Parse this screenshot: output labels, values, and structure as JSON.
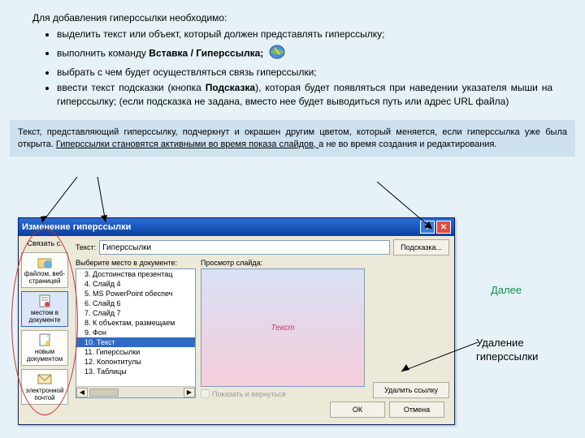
{
  "intro": {
    "heading": "Для добавления гиперссылки необходимо:",
    "li1": "выделить текст или объект, который должен представлять гиперссылку;",
    "li2a": "выполнить команду ",
    "li2b": "Вставка / Гиперссылка;",
    "li3": "выбрать с чем будет осуществляться связь гиперссылки;",
    "li4a": "ввести текст подсказки (кнопка ",
    "li4b": "Подсказка",
    "li4c": "), которая будет появляться при наведении указателя мыши на гиперссылку; (если подсказка не задана, вместо нее будет выводиться путь или адрес URL файла)"
  },
  "note": {
    "p1": "Текст, представляющий гиперссылку, подчеркнут и окрашен другим цветом, который меняется, если гиперссылка уже была открыта. ",
    "u1": "Гиперссылки становятся активными во время показа слайдов, ",
    "p2": "а не во время создания и редактирования."
  },
  "dialog": {
    "title": "Изменение гиперссылки",
    "linkto_label": "Связать с:",
    "linkto": {
      "web": "файлом, веб-страницей",
      "doc": "местом в документе",
      "new": "новым документом",
      "mail": "электронной почтой"
    },
    "text_label": "Текст:",
    "text_value": "Гиперссылки",
    "tip_btn": "Подсказка...",
    "select_label": "Выберите место в документе:",
    "preview_label": "Просмотр слайда:",
    "tree": [
      "3. Достоинства презентац",
      "4. Слайд 4",
      "5. MS PowerPoint обеспеч",
      "6. Слайд 6",
      "7. Слайд 7",
      "8. К объектам, размещаем",
      "9. Фон",
      "10. Текст",
      "11. Гиперссылки",
      "12. Колонтитулы",
      "13. Таблицы"
    ],
    "tree_selected": 7,
    "preview_text": "Текст",
    "show_return": "Показать и вернуться",
    "remove_btn": "Удалить ссылку",
    "ok": "ОК",
    "cancel": "Отмена"
  },
  "labels": {
    "next": "Далее",
    "delete_link": "Удаление гиперссылки"
  }
}
